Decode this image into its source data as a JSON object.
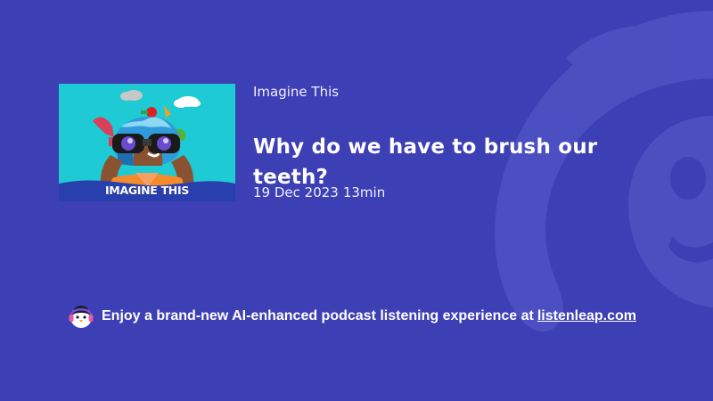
{
  "episode": {
    "show_name": "Imagine This",
    "title": "Why do we have to brush our teeth?",
    "date": "19 Dec 2023",
    "duration": "13min",
    "cover_caption": "IMAGINE THIS"
  },
  "footer": {
    "promo_text": "Enjoy a brand-new AI-enhanced podcast listening experience at",
    "link_text": "listenleap.com"
  },
  "colors": {
    "background": "#3d3fb4",
    "cover_background": "#1ecad4",
    "text": "#ffffff"
  },
  "icons": {
    "mascot": "penguin-headphones-icon",
    "background_logo": "listenleap-logo-watermark"
  }
}
